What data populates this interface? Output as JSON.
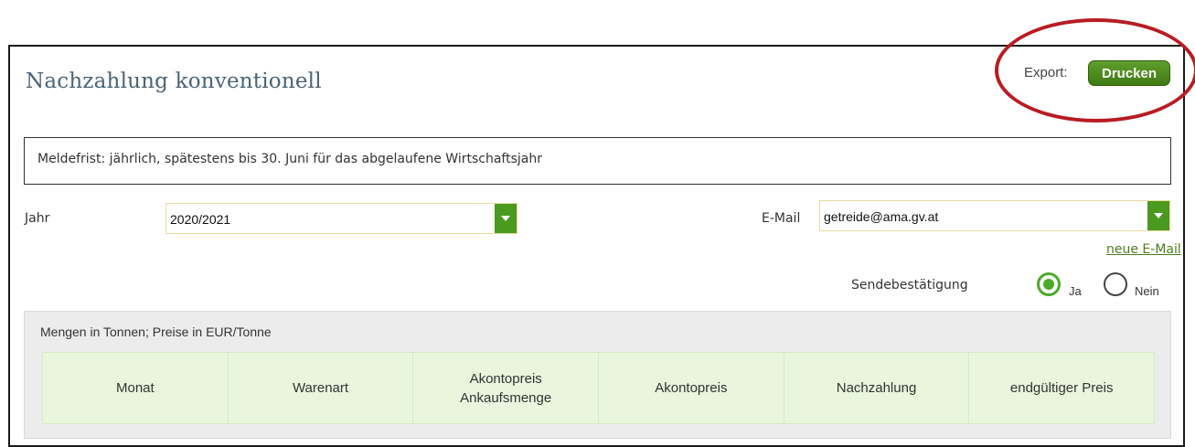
{
  "page": {
    "title": "Nachzahlung konventionell",
    "export_label": "Export:",
    "print_button": "Drucken"
  },
  "notice": "Meldefrist: jährlich, spätestens bis 30. Juni für das abgelaufene Wirtschaftsjahr",
  "form": {
    "year": {
      "label": "Jahr",
      "value": "2020/2021"
    },
    "email": {
      "label": "E-Mail",
      "value": "getreide@ama.gv.at"
    },
    "new_email_link": "neue E-Mail",
    "send_confirmation": {
      "label": "Sendebestätigung",
      "options": [
        {
          "label": "Ja",
          "selected": true
        },
        {
          "label": "Nein",
          "selected": false
        }
      ]
    }
  },
  "table": {
    "caption": "Mengen in Tonnen; Preise in EUR/Tonne",
    "columns": [
      "Monat",
      "Warenart",
      "Akontopreis\nAnkaufsmenge",
      "Akontopreis",
      "Nachzahlung",
      "endgültiger Preis"
    ]
  },
  "colors": {
    "accent_green": "#4a9a1f",
    "highlight_red": "#b81c22",
    "title_color": "#4a6478"
  }
}
